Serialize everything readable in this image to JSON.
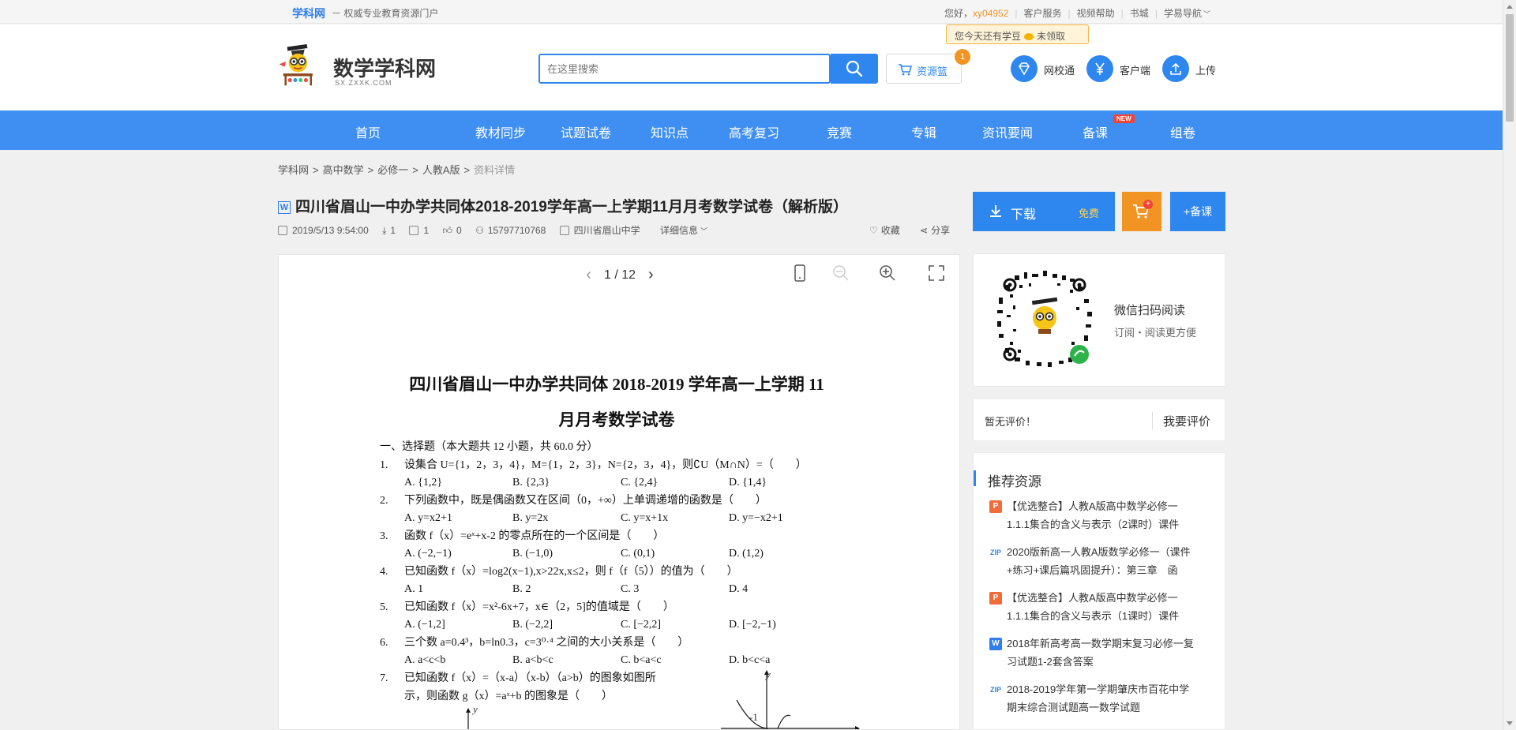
{
  "topbar": {
    "brand": "学科网",
    "tagline": "－ 权威专业教育资源门户",
    "greeting": "您好，",
    "username": "xy04952",
    "links": [
      "客户服务",
      "视频帮助",
      "书城",
      "学易导航"
    ]
  },
  "bean_tip": {
    "text": "您今天还有学豆",
    "status": "未领取"
  },
  "header": {
    "logo_title": "数学学科网",
    "logo_url": "SX.ZXXK.COM",
    "search_placeholder": "在这里搜索",
    "basket_label": "资源篮",
    "basket_count": "1",
    "icons": [
      {
        "label": "网校通",
        "icon": "diamond-icon"
      },
      {
        "label": "客户端",
        "icon": "yuan-icon"
      },
      {
        "label": "上传",
        "icon": "upload-icon"
      }
    ]
  },
  "nav": {
    "items": [
      "首页",
      "教材同步",
      "试题试卷",
      "知识点",
      "高考复习",
      "竞赛",
      "专辑",
      "资讯要闻",
      "备课",
      "组卷"
    ],
    "new_badge": "NEW"
  },
  "breadcrumb": {
    "items": [
      "学科网",
      "高中数学",
      "必修一",
      "人教A版"
    ],
    "current": "资料详情"
  },
  "document": {
    "type_icon": "W",
    "title": "四川省眉山一中办学共同体2018-2019学年高一上学期11月月考数学试卷（解析版）",
    "date": "2019/5/13 9:54:00",
    "downloads": "1",
    "comments": "1",
    "likes": "0",
    "uploader": "15797710768",
    "school": "四川省眉山中学",
    "details_label": "详细信息",
    "favorite_label": "收藏",
    "share_label": "分享"
  },
  "actions": {
    "download_label": "下载",
    "free_label": "免费",
    "add_label": "+备课"
  },
  "viewer": {
    "page_current": "1",
    "page_total": "12"
  },
  "paper": {
    "title_line1": "四川省眉山一中办学共同体 2018-2019 学年高一上学期 11",
    "title_line2": "月月考数学试卷",
    "section": "一、选择题（本大题共 12 小题，共 60.0 分）",
    "questions": [
      {
        "n": "1.",
        "text": "设集合 U={1，2，3，4}，M={1，2，3}，N={2，3，4}，则∁U（M∩N）=（　　）",
        "options": [
          "A. {1,2}",
          "B. {2,3}",
          "C. {2,4}",
          "D. {1,4}"
        ]
      },
      {
        "n": "2.",
        "text": "下列函数中，既是偶函数又在区间（0，+∞）上单调递增的函数是（　　）",
        "options": [
          "A. y=x2+1",
          "B. y=2x",
          "C. y=x+1x",
          "D. y=−x2+1"
        ]
      },
      {
        "n": "3.",
        "text": "函数 f（x）=eˣ+x-2 的零点所在的一个区间是（　　）",
        "options": [
          "A. (−2,−1)",
          "B. (−1,0)",
          "C. (0,1)",
          "D. (1,2)"
        ]
      },
      {
        "n": "4.",
        "text": "已知函数 f（x）=log2(x−1),x>22x,x≤2，则 f（f（5））的值为（　　）",
        "options": [
          "A. 1",
          "B. 2",
          "C. 3",
          "D. 4"
        ]
      },
      {
        "n": "5.",
        "text": "已知函数 f（x）=x²-6x+7，x∈（2，5]的值域是（　　）",
        "options": [
          "A. (−1,2]",
          "B. (−2,2]",
          "C. [−2,2]",
          "D. [−2,−1)"
        ]
      },
      {
        "n": "6.",
        "text": "三个数 a=0.4³，b=ln0.3，c=3⁰·⁴ 之间的大小关系是（　　）",
        "options": [
          "A. a<c<b",
          "B. a<b<c",
          "C. b<a<c",
          "D. b<c<a"
        ]
      },
      {
        "n": "7.",
        "text": "已知函数 f（x）=（x-a）（x-b）（a>b）的图象如图所",
        "line2": "示，则函数 g（x）=aˣ+b 的图象是（　　）"
      }
    ],
    "graph_labels": {
      "y": "y",
      "neg1": "-1"
    }
  },
  "qr_card": {
    "title": "微信扫码阅读",
    "subtitle": "订阅・阅读更方便"
  },
  "evaluation": {
    "none_text": "暂无评价！",
    "button": "我要评价"
  },
  "recommend": {
    "heading": "推荐资源",
    "items": [
      {
        "type": "P",
        "line1": "【优选整合】人教A版高中数学必修一",
        "line2": "1.1.1集合的含义与表示（2课时）课件"
      },
      {
        "type": "ZIP",
        "line1": "2020版新高一人教A版数学必修一（课件",
        "line2": "+练习+课后篇巩固提升）：第三章　函"
      },
      {
        "type": "P",
        "line1": "【优选整合】人教A版高中数学必修一",
        "line2": "1.1.1集合的含义与表示（1课时）课件"
      },
      {
        "type": "W",
        "line1": "2018年新高考高一数学期末复习必修一复",
        "line2": "习试题1-2套含答案"
      },
      {
        "type": "ZIP",
        "line1": "2018-2019学年第一学期肇庆市百花中学",
        "line2": "期末综合测试题高一数学试题"
      }
    ]
  },
  "colors": {
    "primary": "#2e86ef",
    "nav": "#3f8ff3",
    "orange": "#f29424"
  }
}
